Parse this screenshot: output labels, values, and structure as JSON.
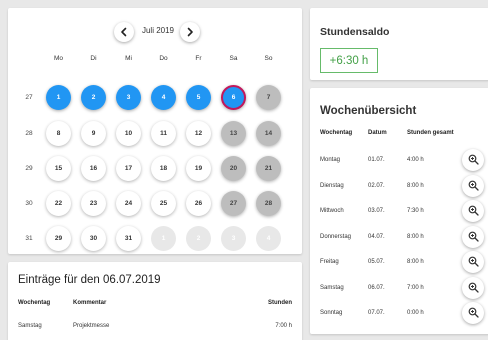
{
  "calendar": {
    "month_label": "Juli 2019",
    "weekdays": [
      "Mo",
      "Di",
      "Mi",
      "Do",
      "Fr",
      "Sa",
      "So"
    ],
    "weeks": [
      {
        "number": "27",
        "days": [
          {
            "label": "1",
            "state": "selected"
          },
          {
            "label": "2",
            "state": "selected"
          },
          {
            "label": "3",
            "state": "selected"
          },
          {
            "label": "4",
            "state": "selected"
          },
          {
            "label": "5",
            "state": "selected"
          },
          {
            "label": "6",
            "state": "selected-active"
          },
          {
            "label": "7",
            "state": "weekend"
          }
        ]
      },
      {
        "number": "28",
        "days": [
          {
            "label": "8",
            "state": "normal"
          },
          {
            "label": "9",
            "state": "normal"
          },
          {
            "label": "10",
            "state": "normal"
          },
          {
            "label": "11",
            "state": "normal"
          },
          {
            "label": "12",
            "state": "normal"
          },
          {
            "label": "13",
            "state": "weekend"
          },
          {
            "label": "14",
            "state": "weekend"
          }
        ]
      },
      {
        "number": "29",
        "days": [
          {
            "label": "15",
            "state": "normal"
          },
          {
            "label": "16",
            "state": "normal"
          },
          {
            "label": "17",
            "state": "normal"
          },
          {
            "label": "18",
            "state": "normal"
          },
          {
            "label": "19",
            "state": "normal"
          },
          {
            "label": "20",
            "state": "weekend"
          },
          {
            "label": "21",
            "state": "weekend"
          }
        ]
      },
      {
        "number": "30",
        "days": [
          {
            "label": "22",
            "state": "normal"
          },
          {
            "label": "23",
            "state": "normal"
          },
          {
            "label": "24",
            "state": "normal"
          },
          {
            "label": "25",
            "state": "normal"
          },
          {
            "label": "26",
            "state": "normal"
          },
          {
            "label": "27",
            "state": "weekend"
          },
          {
            "label": "28",
            "state": "weekend"
          }
        ]
      },
      {
        "number": "31",
        "days": [
          {
            "label": "29",
            "state": "normal"
          },
          {
            "label": "30",
            "state": "normal"
          },
          {
            "label": "31",
            "state": "normal"
          },
          {
            "label": "1",
            "state": "outside"
          },
          {
            "label": "2",
            "state": "outside"
          },
          {
            "label": "3",
            "state": "outside"
          },
          {
            "label": "4",
            "state": "outside"
          }
        ]
      }
    ]
  },
  "entries": {
    "title": "Einträge für den 06.07.2019",
    "headers": {
      "weekday": "Wochentag",
      "comment": "Kommentar",
      "hours": "Stunden"
    },
    "rows": [
      {
        "weekday": "Samstag",
        "comment": "Projektmesse",
        "hours": "7:00 h"
      }
    ]
  },
  "saldo": {
    "title": "Stundensaldo",
    "value": "+6:30 h"
  },
  "week": {
    "title": "Wochenübersicht",
    "headers": {
      "weekday": "Wochentag",
      "date": "Datum",
      "hours": "Stunden gesamt"
    },
    "rows": [
      {
        "weekday": "Montag",
        "date": "01.07.",
        "hours": "4:00 h"
      },
      {
        "weekday": "Dienstag",
        "date": "02.07.",
        "hours": "8:00 h"
      },
      {
        "weekday": "Mittwoch",
        "date": "03.07.",
        "hours": "7:30 h"
      },
      {
        "weekday": "Donnerstag",
        "date": "04.07.",
        "hours": "8:00 h"
      },
      {
        "weekday": "Freitag",
        "date": "05.07.",
        "hours": "8:00 h"
      },
      {
        "weekday": "Samstag",
        "date": "06.07.",
        "hours": "7:00 h"
      },
      {
        "weekday": "Sonntag",
        "date": "07.07.",
        "hours": "0:00 h"
      }
    ]
  },
  "icons": {
    "prev": "chevron-left-icon",
    "next": "chevron-right-icon",
    "details": "zoom-in-icon"
  },
  "colors": {
    "selected_day": "#2196f3",
    "active_day_border": "#c2185b",
    "weekend_day": "#bdbdbd",
    "saldo_accent": "#43a047"
  }
}
